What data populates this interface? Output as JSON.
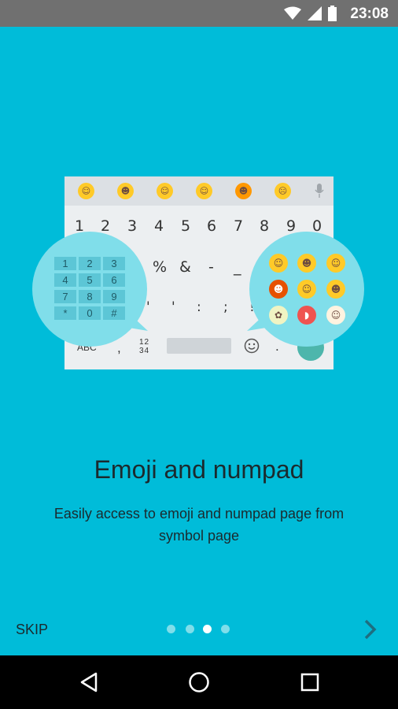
{
  "status_bar": {
    "time": "23:08",
    "icons": [
      "wifi-icon",
      "signal-icon",
      "battery-icon"
    ]
  },
  "keyboard_illustration": {
    "emoji_suggestions": [
      "☺",
      "☻",
      "☺",
      "☺",
      "☻",
      "☹"
    ],
    "digit_row": [
      "1",
      "2",
      "3",
      "4",
      "5",
      "6",
      "7",
      "8",
      "9",
      "0"
    ],
    "symbol_row_1": [
      "%",
      "&",
      "-",
      "_"
    ],
    "symbol_row_2": [
      "'",
      "'",
      ":",
      ";",
      "!"
    ],
    "bottom_row": {
      "abc_label": "ABC",
      "comma": ",",
      "numpad_label": "12\n34",
      "period": "."
    },
    "numpad_keys": [
      "1",
      "2",
      "3",
      "4",
      "5",
      "6",
      "7",
      "8",
      "9",
      "*",
      "0",
      "#"
    ],
    "emoji_grid": [
      "☺",
      "☻",
      "☺",
      "☻",
      "☺",
      "☻",
      "✿",
      "◗",
      "☺"
    ]
  },
  "content": {
    "title": "Emoji and numpad",
    "description": "Easily access to emoji and numpad page from symbol page"
  },
  "footer": {
    "skip_label": "SKIP",
    "page_indicator": {
      "total": 4,
      "active_index": 2
    }
  },
  "colors": {
    "background": "#00BCD9",
    "status_bar": "#707070",
    "bubble": "#80DEEA",
    "emoji_yellow": "#FFCA28",
    "enter_key": "#4DB6AC"
  },
  "nav_bar": {
    "icons": [
      "back-icon",
      "home-icon",
      "recents-icon"
    ]
  }
}
